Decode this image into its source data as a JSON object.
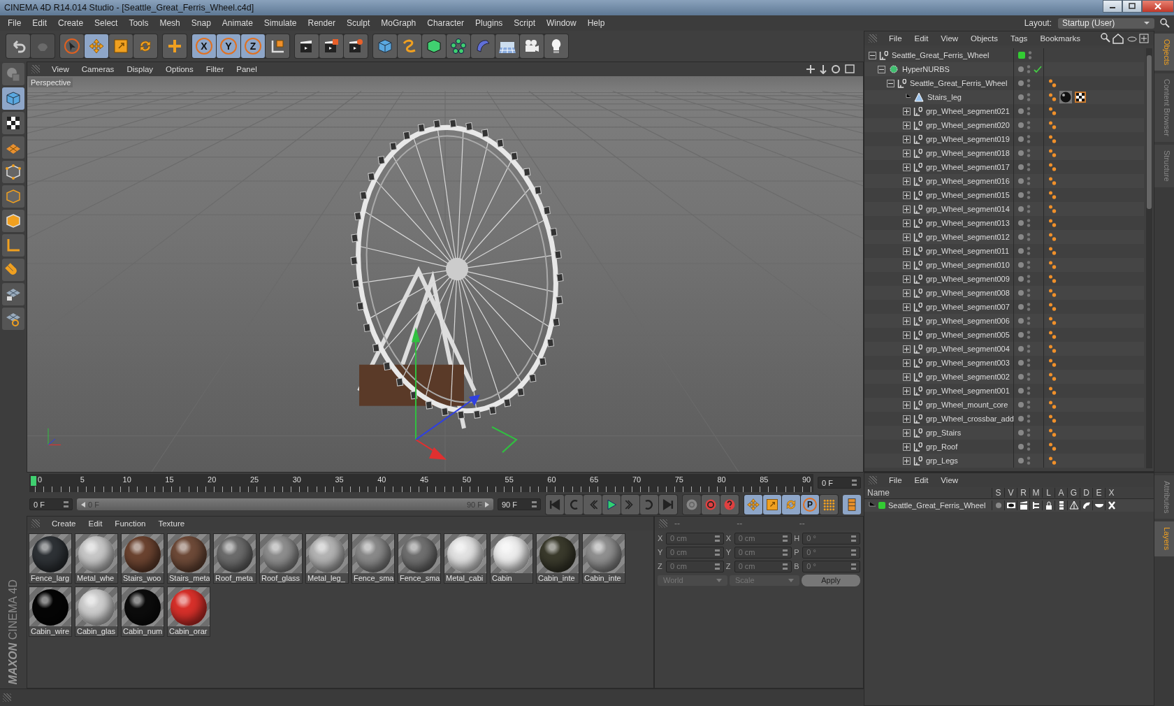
{
  "window": {
    "title": "CINEMA 4D R14.014 Studio - [Seattle_Great_Ferris_Wheel.c4d]"
  },
  "menu_bar": [
    "File",
    "Edit",
    "Create",
    "Select",
    "Tools",
    "Mesh",
    "Snap",
    "Animate",
    "Simulate",
    "Render",
    "Sculpt",
    "MoGraph",
    "Character",
    "Plugins",
    "Script",
    "Window",
    "Help"
  ],
  "layout": {
    "label": "Layout:",
    "value": "Startup (User)"
  },
  "toolbar": [
    [
      {
        "kind": "undo",
        "disabled": false
      },
      {
        "kind": "redo",
        "disabled": true
      }
    ],
    [
      {
        "kind": "select",
        "selected": false
      },
      {
        "kind": "move",
        "selected": true
      },
      {
        "kind": "scale",
        "selected": false
      },
      {
        "kind": "rotate",
        "selected": false
      }
    ],
    [
      {
        "kind": "add",
        "selected": false
      }
    ],
    [
      {
        "kind": "axis",
        "label": "X",
        "selected": true
      },
      {
        "kind": "axis",
        "label": "Y",
        "selected": true
      },
      {
        "kind": "axis",
        "label": "Z",
        "selected": true
      },
      {
        "kind": "coords",
        "selected": false
      }
    ],
    [
      {
        "kind": "render_view",
        "selected": false
      },
      {
        "kind": "render_picture",
        "selected": false
      },
      {
        "kind": "render_settings",
        "selected": false
      }
    ],
    [
      {
        "kind": "cube",
        "selected": false
      },
      {
        "kind": "spline",
        "selected": false
      },
      {
        "kind": "subdivision",
        "selected": false
      },
      {
        "kind": "cloner",
        "selected": false
      },
      {
        "kind": "deformer",
        "selected": false
      },
      {
        "kind": "floor",
        "selected": false
      },
      {
        "kind": "camera",
        "selected": false
      },
      {
        "kind": "light",
        "selected": false
      }
    ]
  ],
  "left_tools": [
    {
      "kind": "editable",
      "selected": false
    },
    {
      "kind": "model",
      "selected": true
    },
    {
      "kind": "texture",
      "selected": false
    },
    {
      "kind": "workplane",
      "selected": false
    },
    {
      "kind": "points",
      "selected": false
    },
    {
      "kind": "edges",
      "selected": false
    },
    {
      "kind": "polygons",
      "selected": false
    },
    {
      "kind": "axis",
      "selected": false
    },
    {
      "kind": "magnet",
      "selected": false
    },
    {
      "kind": "lock_grid",
      "selected": false
    },
    {
      "kind": "snap_grid",
      "selected": false
    }
  ],
  "logo": {
    "brand": "MAXON",
    "product": "CINEMA 4D"
  },
  "viewport": {
    "menu": [
      "View",
      "Cameras",
      "Display",
      "Options",
      "Filter",
      "Panel"
    ],
    "label": "Perspective"
  },
  "timeline": {
    "ticks": [
      "0",
      "5",
      "10",
      "15",
      "20",
      "25",
      "30",
      "35",
      "40",
      "45",
      "50",
      "55",
      "60",
      "65",
      "70",
      "75",
      "80",
      "85",
      "90"
    ],
    "current_frame": "0 F",
    "start": "0 F",
    "range": {
      "start": "0 F",
      "end": "90 F",
      "level": 1
    },
    "end": "90 F",
    "playback": [
      {
        "kind": "to_start"
      },
      {
        "kind": "prev_key"
      },
      {
        "kind": "prev_frame"
      },
      {
        "kind": "play"
      },
      {
        "kind": "next_frame"
      },
      {
        "kind": "next_key"
      },
      {
        "kind": "to_end"
      }
    ],
    "record": [
      {
        "kind": "autokey",
        "disabled": true
      },
      {
        "kind": "record",
        "disabled": false
      },
      {
        "kind": "help",
        "disabled": false
      }
    ],
    "keys": [
      {
        "kind": "move",
        "selected": true
      },
      {
        "kind": "scale",
        "selected": true
      },
      {
        "kind": "rotate",
        "selected": true
      },
      {
        "kind": "param",
        "label": "P",
        "selected": true
      },
      {
        "kind": "dots",
        "selected": false
      }
    ]
  },
  "materials": {
    "menu": [
      "Create",
      "Edit",
      "Function",
      "Texture"
    ],
    "items": [
      {
        "name": "Fence_larg",
        "color": "#2e3236"
      },
      {
        "name": "Metal_whe",
        "color": "#c8c8c8"
      },
      {
        "name": "Stairs_woo",
        "color": "#6b4330"
      },
      {
        "name": "Stairs_meta",
        "color": "#6e4a38"
      },
      {
        "name": "Roof_meta",
        "color": "#6c6c6c"
      },
      {
        "name": "Roof_glass",
        "color": "#8e8e8e"
      },
      {
        "name": "Metal_leg_",
        "color": "#b4b4b4"
      },
      {
        "name": "Fence_sma",
        "color": "#8a8a8a"
      },
      {
        "name": "Fence_sma",
        "color": "#707070"
      },
      {
        "name": "Metal_cabi",
        "color": "#e2e2e2"
      },
      {
        "name": "Cabin",
        "color": "#eeeeee"
      },
      {
        "name": "Cabin_inte",
        "color": "#3a3a2c"
      },
      {
        "name": "Cabin_inte",
        "color": "#909090"
      },
      {
        "name": "Cabin_wire",
        "color": "#050505"
      },
      {
        "name": "Cabin_glas",
        "color": "#cfcfcf"
      },
      {
        "name": "Cabin_num",
        "color": "#0c0c0c"
      },
      {
        "name": "Cabin_orar",
        "color": "#d8302a"
      }
    ]
  },
  "coordinates": {
    "disabled": true,
    "headers": [
      "--",
      "--",
      "--"
    ],
    "rows": [
      [
        {
          "label": "X",
          "value": "0 cm"
        },
        {
          "label": "X",
          "value": "0 cm"
        },
        {
          "label": "H",
          "value": "0 °"
        }
      ],
      [
        {
          "label": "Y",
          "value": "0 cm"
        },
        {
          "label": "Y",
          "value": "0 cm"
        },
        {
          "label": "P",
          "value": "0 °"
        }
      ],
      [
        {
          "label": "Z",
          "value": "0 cm"
        },
        {
          "label": "Z",
          "value": "0 cm"
        },
        {
          "label": "B",
          "value": "0 °"
        }
      ]
    ],
    "dropdowns": [
      "World",
      "Scale"
    ],
    "apply": "Apply"
  },
  "object_manager": {
    "menu": [
      "File",
      "Edit",
      "View",
      "Objects",
      "Tags",
      "Bookmarks"
    ],
    "tree": [
      {
        "name": "Seattle_Great_Ferris_Wheel",
        "kind": "null",
        "expanded": true,
        "color": "#33cc33",
        "children": [
          {
            "name": "HyperNURBS",
            "kind": "nurbs",
            "expanded": true,
            "enabled": true,
            "children": [
              {
                "name": "Seattle_Great_Ferris_Wheel",
                "kind": "null",
                "expanded": true,
                "tags": [
                  {
                    "kind": "phong"
                  }
                ],
                "children": [
                  {
                    "name": "Stairs_leg",
                    "kind": "polygon",
                    "tags": [
                      {
                        "kind": "phong"
                      },
                      {
                        "kind": "material"
                      },
                      {
                        "kind": "texture"
                      }
                    ]
                  },
                  {
                    "name": "grp_Wheel_segment021",
                    "kind": "null",
                    "expanded": false,
                    "tags": [
                      {
                        "kind": "phong"
                      }
                    ]
                  },
                  {
                    "name": "grp_Wheel_segment020",
                    "kind": "null",
                    "expanded": false,
                    "tags": [
                      {
                        "kind": "phong"
                      }
                    ]
                  },
                  {
                    "name": "grp_Wheel_segment019",
                    "kind": "null",
                    "expanded": false,
                    "tags": [
                      {
                        "kind": "phong"
                      }
                    ]
                  },
                  {
                    "name": "grp_Wheel_segment018",
                    "kind": "null",
                    "expanded": false,
                    "tags": [
                      {
                        "kind": "phong"
                      }
                    ]
                  },
                  {
                    "name": "grp_Wheel_segment017",
                    "kind": "null",
                    "expanded": false,
                    "tags": [
                      {
                        "kind": "phong"
                      }
                    ]
                  },
                  {
                    "name": "grp_Wheel_segment016",
                    "kind": "null",
                    "expanded": false,
                    "tags": [
                      {
                        "kind": "phong"
                      }
                    ]
                  },
                  {
                    "name": "grp_Wheel_segment015",
                    "kind": "null",
                    "expanded": false,
                    "tags": [
                      {
                        "kind": "phong"
                      }
                    ]
                  },
                  {
                    "name": "grp_Wheel_segment014",
                    "kind": "null",
                    "expanded": false,
                    "tags": [
                      {
                        "kind": "phong"
                      }
                    ]
                  },
                  {
                    "name": "grp_Wheel_segment013",
                    "kind": "null",
                    "expanded": false,
                    "tags": [
                      {
                        "kind": "phong"
                      }
                    ]
                  },
                  {
                    "name": "grp_Wheel_segment012",
                    "kind": "null",
                    "expanded": false,
                    "tags": [
                      {
                        "kind": "phong"
                      }
                    ]
                  },
                  {
                    "name": "grp_Wheel_segment011",
                    "kind": "null",
                    "expanded": false,
                    "tags": [
                      {
                        "kind": "phong"
                      }
                    ]
                  },
                  {
                    "name": "grp_Wheel_segment010",
                    "kind": "null",
                    "expanded": false,
                    "tags": [
                      {
                        "kind": "phong"
                      }
                    ]
                  },
                  {
                    "name": "grp_Wheel_segment009",
                    "kind": "null",
                    "expanded": false,
                    "tags": [
                      {
                        "kind": "phong"
                      }
                    ]
                  },
                  {
                    "name": "grp_Wheel_segment008",
                    "kind": "null",
                    "expanded": false,
                    "tags": [
                      {
                        "kind": "phong"
                      }
                    ]
                  },
                  {
                    "name": "grp_Wheel_segment007",
                    "kind": "null",
                    "expanded": false,
                    "tags": [
                      {
                        "kind": "phong"
                      }
                    ]
                  },
                  {
                    "name": "grp_Wheel_segment006",
                    "kind": "null",
                    "expanded": false,
                    "tags": [
                      {
                        "kind": "phong"
                      }
                    ]
                  },
                  {
                    "name": "grp_Wheel_segment005",
                    "kind": "null",
                    "expanded": false,
                    "tags": [
                      {
                        "kind": "phong"
                      }
                    ]
                  },
                  {
                    "name": "grp_Wheel_segment004",
                    "kind": "null",
                    "expanded": false,
                    "tags": [
                      {
                        "kind": "phong"
                      }
                    ]
                  },
                  {
                    "name": "grp_Wheel_segment003",
                    "kind": "null",
                    "expanded": false,
                    "tags": [
                      {
                        "kind": "phong"
                      }
                    ]
                  },
                  {
                    "name": "grp_Wheel_segment002",
                    "kind": "null",
                    "expanded": false,
                    "tags": [
                      {
                        "kind": "phong"
                      }
                    ]
                  },
                  {
                    "name": "grp_Wheel_segment001",
                    "kind": "null",
                    "expanded": false,
                    "tags": [
                      {
                        "kind": "phong"
                      }
                    ]
                  },
                  {
                    "name": "grp_Wheel_mount_core",
                    "kind": "null",
                    "expanded": false,
                    "tags": [
                      {
                        "kind": "phong"
                      }
                    ]
                  },
                  {
                    "name": "grp_Wheel_crossbar_add",
                    "kind": "null",
                    "expanded": false,
                    "tags": [
                      {
                        "kind": "phong"
                      }
                    ]
                  },
                  {
                    "name": "grp_Stairs",
                    "kind": "null",
                    "expanded": false,
                    "tags": [
                      {
                        "kind": "phong"
                      }
                    ]
                  },
                  {
                    "name": "grp_Roof",
                    "kind": "null",
                    "expanded": false,
                    "tags": [
                      {
                        "kind": "phong"
                      }
                    ]
                  },
                  {
                    "name": "grp_Legs",
                    "kind": "null",
                    "expanded": false,
                    "tags": [
                      {
                        "kind": "phong"
                      }
                    ]
                  }
                ]
              }
            ]
          }
        ]
      }
    ]
  },
  "object_tabs": [
    {
      "label": "Objects",
      "selected": true
    },
    {
      "label": "Content Browser",
      "selected": false
    },
    {
      "label": "Structure",
      "selected": false
    }
  ],
  "layers": {
    "menu": [
      "File",
      "Edit",
      "View"
    ],
    "columns": [
      "Name",
      "S",
      "V",
      "R",
      "M",
      "L",
      "A",
      "G",
      "D",
      "E",
      "X"
    ],
    "rows": [
      {
        "name": "Seattle_Great_Ferris_Wheel",
        "color": "#33cc33"
      }
    ]
  },
  "layer_tabs": [
    {
      "label": "Attributes",
      "selected": false
    },
    {
      "label": "Layers",
      "selected": true
    }
  ]
}
